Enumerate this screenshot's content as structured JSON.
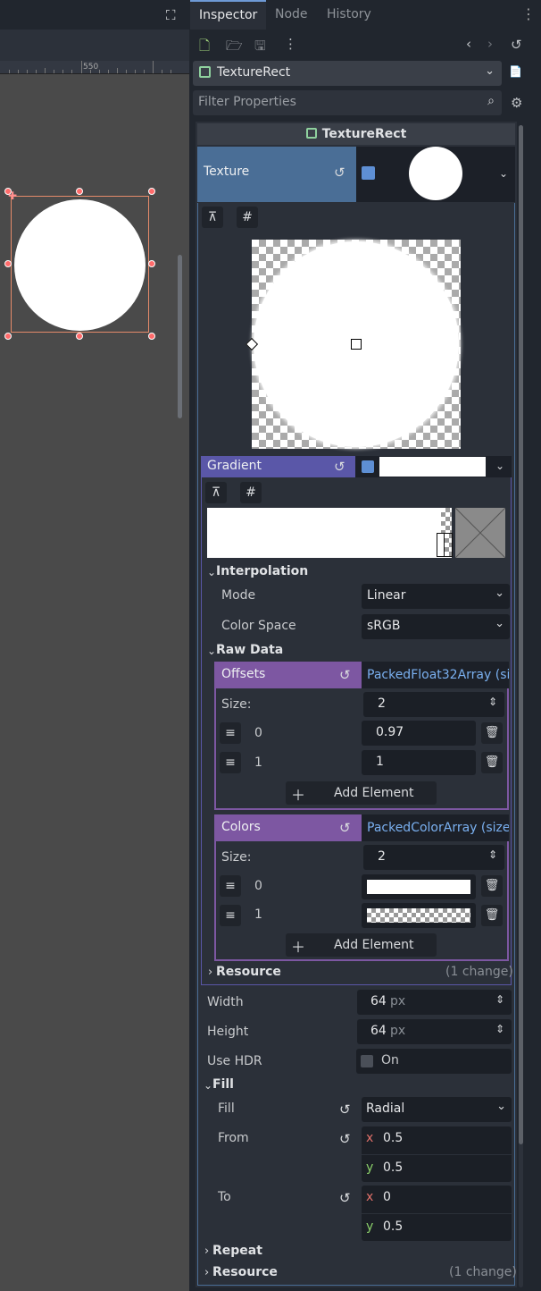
{
  "viewport": {
    "ruler_label": "550",
    "expand_icon": "expand-icon"
  },
  "tabs": {
    "inspector": "Inspector",
    "node": "Node",
    "history": "History"
  },
  "node_select": {
    "value": "TextureRect"
  },
  "filter": {
    "placeholder": "Filter Properties"
  },
  "section": {
    "title": "TextureRect"
  },
  "texture": {
    "label": "Texture"
  },
  "gradient": {
    "label": "Gradient",
    "interpolation": {
      "title": "Interpolation",
      "mode_label": "Mode",
      "mode_value": "Linear",
      "color_space_label": "Color Space",
      "color_space_value": "sRGB"
    },
    "raw_data": {
      "title": "Raw Data",
      "offsets": {
        "label": "Offsets",
        "value": "PackedFloat32Array (si",
        "size_label": "Size:",
        "size": "2",
        "items": [
          {
            "index": "0",
            "value": "0.97"
          },
          {
            "index": "1",
            "value": "1"
          }
        ],
        "add_label": "Add Element"
      },
      "colors": {
        "label": "Colors",
        "value": "PackedColorArray (size",
        "size_label": "Size:",
        "size": "2",
        "items": [
          {
            "index": "0"
          },
          {
            "index": "1"
          }
        ],
        "add_label": "Add Element"
      }
    },
    "resource": {
      "label": "Resource",
      "changes": "(1 change)"
    }
  },
  "width": {
    "label": "Width",
    "value": "64",
    "unit": "px"
  },
  "height": {
    "label": "Height",
    "value": "64",
    "unit": "px"
  },
  "use_hdr": {
    "label": "Use HDR",
    "value": "On"
  },
  "fill": {
    "title": "Fill",
    "fill_label": "Fill",
    "fill_value": "Radial",
    "from_label": "From",
    "from_x": "0.5",
    "from_y": "0.5",
    "to_label": "To",
    "to_x": "0",
    "to_y": "0.5",
    "x": "x",
    "y": "y"
  },
  "repeat": {
    "label": "Repeat"
  },
  "resource": {
    "label": "Resource",
    "changes": "(1 change)"
  },
  "colors": {
    "accent": "#6e9ad6",
    "texture_row": "#4a6e96",
    "gradient_row": "#5a57a8",
    "array_row": "#7d57a2",
    "handle": "#ff6b6b"
  }
}
